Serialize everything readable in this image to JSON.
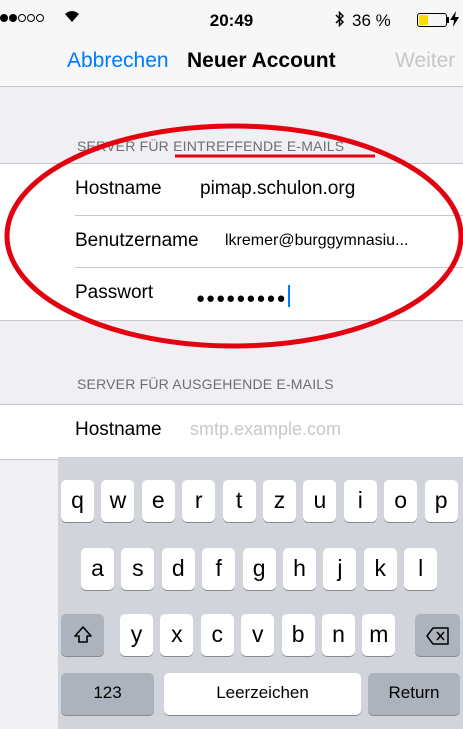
{
  "status_bar": {
    "time": "20:49",
    "battery_percent": "36 %",
    "battery_level": 0.36,
    "signal_bars_filled": 2,
    "signal_bars_total": 5,
    "icons": [
      "signal-dots-icon",
      "wifi-icon",
      "bluetooth-icon",
      "battery-icon",
      "charging-icon"
    ],
    "battery_color": "#fedb00"
  },
  "nav_bar": {
    "cancel_label": "Abbrechen",
    "title": "Neuer Account",
    "next_label": "Weiter"
  },
  "incoming": {
    "header": "SERVER FÜR EINTREFFENDE E-MAILS",
    "rows": [
      {
        "label": "Hostname",
        "value": "pimap.schulon.org"
      },
      {
        "label": "Benutzername",
        "value": "lkremer@burggymnasiu..."
      },
      {
        "label": "Passwort",
        "value": "●●●●●●●●●"
      }
    ]
  },
  "outgoing": {
    "header": "SERVER FÜR AUSGEHENDE E-MAILS",
    "rows": [
      {
        "label": "Hostname",
        "placeholder": "smtp.example.com"
      }
    ]
  },
  "keyboard": {
    "row1": [
      "q",
      "w",
      "e",
      "r",
      "t",
      "z",
      "u",
      "i",
      "o",
      "p"
    ],
    "row2": [
      "a",
      "s",
      "d",
      "f",
      "g",
      "h",
      "j",
      "k",
      "l"
    ],
    "row3": [
      "y",
      "x",
      "c",
      "v",
      "b",
      "n",
      "m"
    ],
    "shift_icon": "shift-icon",
    "delete_icon": "delete-icon",
    "numbers_label": "123",
    "space_label": "Leerzeichen",
    "return_label": "Return"
  },
  "colors": {
    "accent": "#007aff",
    "annotation_red": "#e3000f",
    "disabled": "#c7c7cc"
  }
}
